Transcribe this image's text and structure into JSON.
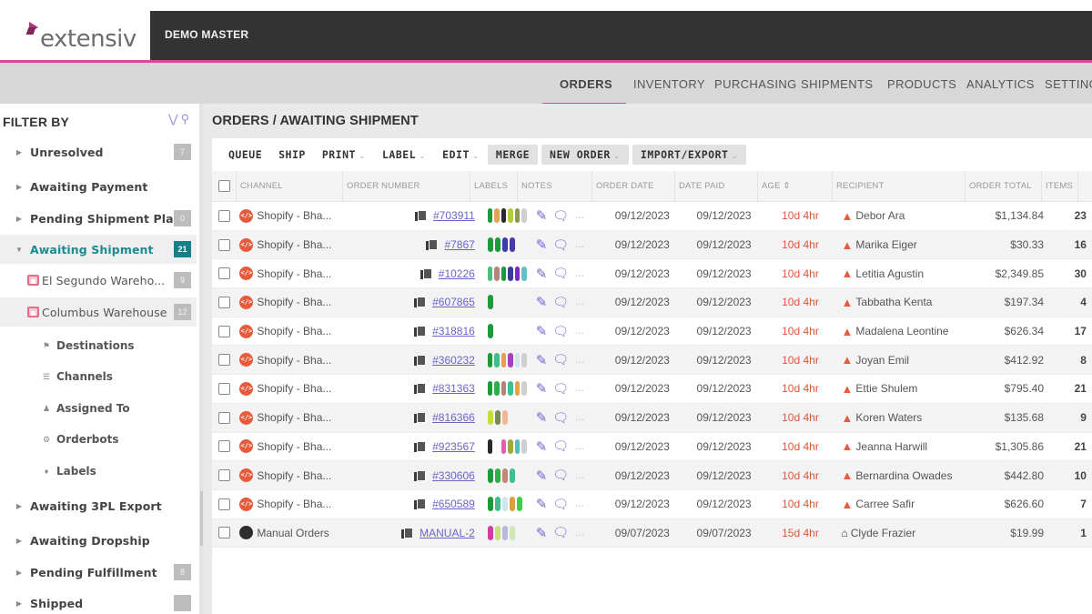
{
  "brand": {
    "logo_text": "extensiv",
    "account": "DEMO MASTER",
    "accent": "#d9479c",
    "teal": "#15808a"
  },
  "nav": {
    "items": [
      "ORDERS",
      "INVENTORY",
      "PURCHASING",
      "SHIPMENTS",
      "PRODUCTS",
      "ANALYTICS",
      "SETTINGS"
    ],
    "active": "ORDERS"
  },
  "sidebar": {
    "title": "FILTER BY",
    "items": [
      {
        "label": "Unresolved",
        "count": "7"
      },
      {
        "label": "Awaiting Payment",
        "count": ""
      },
      {
        "label": "Pending Shipment Plan",
        "count": "0"
      },
      {
        "label": "Awaiting Shipment",
        "count": "21",
        "selected": true
      },
      {
        "label": "El Segundo Wareho...",
        "count": "9"
      },
      {
        "label": "Columbus Warehouse",
        "count": "12"
      },
      {
        "label": "Destinations"
      },
      {
        "label": "Channels"
      },
      {
        "label": "Assigned To"
      },
      {
        "label": "Orderbots"
      },
      {
        "label": "Labels"
      },
      {
        "label": "Awaiting 3PL Export",
        "count": ""
      },
      {
        "label": "Awaiting Dropship",
        "count": ""
      },
      {
        "label": "Pending Fulfillment",
        "count": "8"
      },
      {
        "label": "Shipped",
        "count": ""
      }
    ]
  },
  "main": {
    "title": "ORDERS / AWAITING SHIPMENT",
    "toolbar": {
      "queue": "QUEUE",
      "ship": "SHIP",
      "print": "PRINT",
      "label": "LABEL",
      "edit": "EDIT",
      "merge": "MERGE",
      "new_order": "NEW ORDER",
      "import_export": "IMPORT/EXPORT"
    },
    "columns": [
      "CHANNEL",
      "ORDER NUMBER",
      "LABELS",
      "NOTES",
      "ORDER DATE",
      "DATE PAID",
      "AGE",
      "RECIPIENT",
      "ORDER TOTAL",
      "ITEMS"
    ],
    "rows": [
      {
        "channel": "Shopify - Bha...",
        "order": "#703911",
        "labels": [
          "#1e9a3a",
          "#e3a35b",
          "#2a2a2a",
          "#b5cc3a",
          "#8a9a55",
          "#cfcfcf"
        ],
        "order_date": "09/12/2023",
        "date_paid": "09/12/2023",
        "age": "10d 4hr",
        "recipient": "Debor Ara",
        "total": "$1,134.84",
        "items": "23",
        "status": "warning"
      },
      {
        "channel": "Shopify - Bha...",
        "order": "#7867",
        "labels": [
          "#1e9a3a",
          "#1e9a3a",
          "#3b3ea8",
          "#4a3ba8"
        ],
        "order_date": "09/12/2023",
        "date_paid": "09/12/2023",
        "age": "10d 4hr",
        "recipient": "Marika Eiger",
        "total": "$30.33",
        "items": "16",
        "status": "warning"
      },
      {
        "channel": "Shopify - Bha...",
        "order": "#10226",
        "labels": [
          "#4dbf7a",
          "#b38578",
          "#1e9a3a",
          "#3a3a9a",
          "#7a2ac0",
          "#5cc4c4"
        ],
        "order_date": "09/12/2023",
        "date_paid": "09/12/2023",
        "age": "10d 4hr",
        "recipient": "Letitia Agustin",
        "total": "$2,349.85",
        "items": "30",
        "status": "warning"
      },
      {
        "channel": "Shopify - Bha...",
        "order": "#607865",
        "labels": [
          "#1e9a3a"
        ],
        "order_date": "09/12/2023",
        "date_paid": "09/12/2023",
        "age": "10d 4hr",
        "recipient": "Tabbatha Kenta",
        "total": "$197.34",
        "items": "4",
        "status": "warning"
      },
      {
        "channel": "Shopify - Bha...",
        "order": "#318816",
        "labels": [
          "#1e9a3a"
        ],
        "order_date": "09/12/2023",
        "date_paid": "09/12/2023",
        "age": "10d 4hr",
        "recipient": "Madalena Leontine",
        "total": "$626.34",
        "items": "17",
        "status": "warning"
      },
      {
        "channel": "Shopify - Bha...",
        "order": "#360232",
        "labels": [
          "#1e9a3a",
          "#3fbf8f",
          "#e8a050",
          "#a63fc0",
          "#cfe6ec",
          "#cfcfcf"
        ],
        "order_date": "09/12/2023",
        "date_paid": "09/12/2023",
        "age": "10d 4hr",
        "recipient": "Joyan Emil",
        "total": "$412.92",
        "items": "8",
        "status": "warning"
      },
      {
        "channel": "Shopify - Bha...",
        "order": "#831363",
        "labels": [
          "#1e9a3a",
          "#2fae4a",
          "#b38578",
          "#3fbf8f",
          "#e8a050",
          "#cfcfcf"
        ],
        "order_date": "09/12/2023",
        "date_paid": "09/12/2023",
        "age": "10d 4hr",
        "recipient": "Ettie Shulem",
        "total": "$795.40",
        "items": "21",
        "status": "warning"
      },
      {
        "channel": "Shopify - Bha...",
        "order": "#816366",
        "labels": [
          "#c5dc3a",
          "#7a8a55",
          "#f0b898"
        ],
        "order_date": "09/12/2023",
        "date_paid": "09/12/2023",
        "age": "10d 4hr",
        "recipient": "Koren Waters",
        "total": "$135.68",
        "items": "9",
        "status": "warning"
      },
      {
        "channel": "Shopify - Bha...",
        "order": "#923567",
        "labels": [
          "#2a2a2a",
          "#ffffff",
          "#e060b0",
          "#9aac3a",
          "#5cb8c0",
          "#cfcfcf"
        ],
        "order_date": "09/12/2023",
        "date_paid": "09/12/2023",
        "age": "10d 4hr",
        "recipient": "Jeanna Harwill",
        "total": "$1,305.86",
        "items": "21",
        "status": "warning"
      },
      {
        "channel": "Shopify - Bha...",
        "order": "#330606",
        "labels": [
          "#1e9a3a",
          "#2fae4a",
          "#c08878",
          "#3fbf8f"
        ],
        "order_date": "09/12/2023",
        "date_paid": "09/12/2023",
        "age": "10d 4hr",
        "recipient": "Bernardina Owades",
        "total": "$442.80",
        "items": "10",
        "status": "warning"
      },
      {
        "channel": "Shopify - Bha...",
        "order": "#650589",
        "labels": [
          "#1e9a3a",
          "#3fbf8f",
          "#cfe6ec",
          "#d9a040",
          "#3ad04a"
        ],
        "order_date": "09/12/2023",
        "date_paid": "09/12/2023",
        "age": "10d 4hr",
        "recipient": "Carree Safir",
        "total": "$626.60",
        "items": "7",
        "status": "warning"
      },
      {
        "channel": "Manual Orders",
        "order": "MANUAL-2",
        "labels": [
          "#d040a0",
          "#c8e080",
          "#b8b8e0",
          "#cfe6b8"
        ],
        "order_date": "09/07/2023",
        "date_paid": "09/07/2023",
        "age": "15d 4hr",
        "recipient": "Clyde Frazier",
        "total": "$19.99",
        "items": "1",
        "status": "home",
        "manual": true
      }
    ]
  },
  "icons": {
    "collapse": "chevrons-down-icon",
    "search": "search-icon",
    "warning": "warning-icon",
    "home": "home-icon",
    "edit_note": "edit-note-icon",
    "comment": "comment-icon",
    "more": "more-icon",
    "copy": "copy-icon",
    "sort": "sort-icon"
  }
}
